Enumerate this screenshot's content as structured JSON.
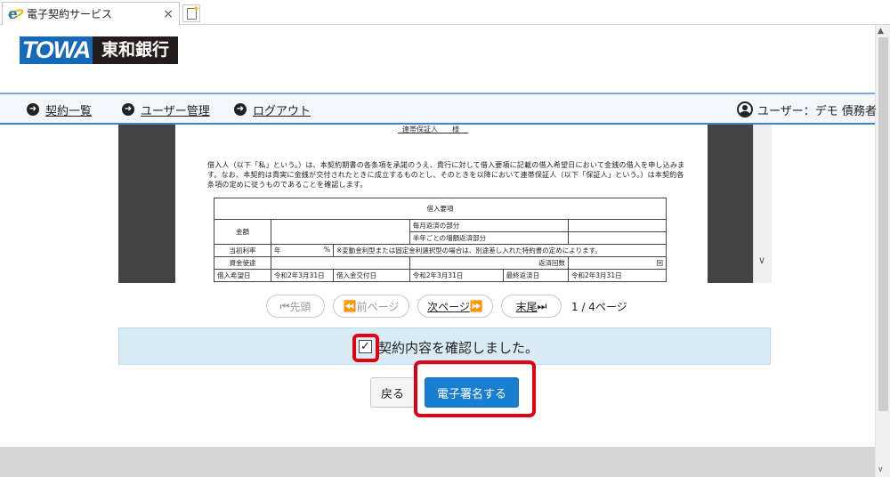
{
  "browser": {
    "tab_title": "電子契約サービス",
    "tab_close": "×"
  },
  "brand": {
    "logo_latin": "TOWA",
    "logo_kanji": "東和銀行",
    "colors": {
      "logo_blue": "#1569b8",
      "logo_dark": "#231c1a",
      "nav_border": "#3e84c8",
      "primary_button": "#1a7fd0",
      "highlight_red": "#e00012"
    }
  },
  "nav": {
    "items": [
      {
        "icon": "arrow-right-circle-icon",
        "label": "契約一覧"
      },
      {
        "icon": "arrow-right-circle-icon",
        "label": "ユーザー管理"
      },
      {
        "icon": "arrow-right-circle-icon",
        "label": "ログアウト"
      }
    ],
    "user_label": "ユーザー：デモ 債務者"
  },
  "document": {
    "guarantor_line": "連帯保証人　　様",
    "intro_text": "借入人（以下「私」という。）は、本契約期書の各条項を承諾のうえ、貴行に対して借入要項に記載の借入希望日において金銭の借入を申し込みます。なお、本契約は貴実に金銭が交付されたときに成立するものとし、そのときを以降において連帯保証人（以下「保証人」という。）は本契約各条項の定めに従うものであることを確認します。",
    "table_title": "借入要項",
    "amount_label": "金額",
    "monthly_label": "毎月返済の部分",
    "bonus_label": "半年ごとの増額返済部分",
    "rate_label": "当初利率",
    "rate_year": "年",
    "rate_percent": "%",
    "rate_note": "※変動金利型または固定金利選択型の場合は、別途差し入れた特約書の定めによります。",
    "purpose_label": "資金使途",
    "repay_count_label": "返済回数",
    "repay_count_unit": "回",
    "row5_a": "借入希望日",
    "row5_b": "令和2年3月31日",
    "row5_c": "借入金交付日",
    "row5_d": "令和2年3月31日",
    "row5_e": "最終返済日",
    "row5_f": "令和2年3月31日"
  },
  "pager": {
    "first": "先頭",
    "prev": "前ページ",
    "next": "次ページ",
    "last": "末尾",
    "current": 1,
    "total": 4,
    "page_info": "1 / 4ページ"
  },
  "confirm": {
    "checked": true,
    "label": "契約内容を確認しました。"
  },
  "actions": {
    "back_label": "戻る",
    "sign_label": "電子署名する"
  }
}
